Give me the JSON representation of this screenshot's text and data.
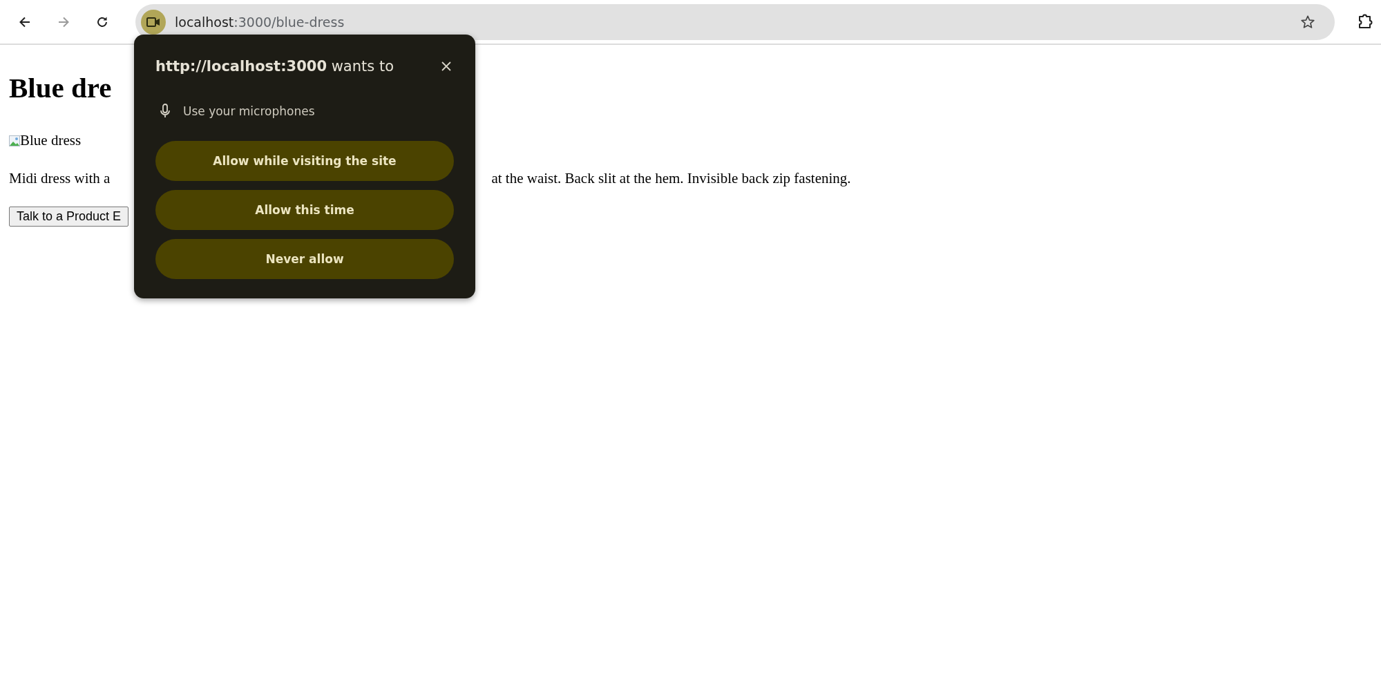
{
  "toolbar": {
    "address": {
      "host": "localhost",
      "path": ":3000/blue-dress"
    },
    "forward_disabled": true
  },
  "page": {
    "heading": "Blue dre",
    "image_alt": "Blue dress",
    "description_start": "Midi dress with a",
    "description_end": "at the waist. Back slit at the hem. Invisible back zip fastening.",
    "button": "Talk to a Product E"
  },
  "permission_popup": {
    "title": "**http://localhost:3000** wants to",
    "permission": "Use your microphones",
    "buttons": [
      "Allow while visiting the site",
      "Allow this time",
      "Never allow"
    ]
  }
}
